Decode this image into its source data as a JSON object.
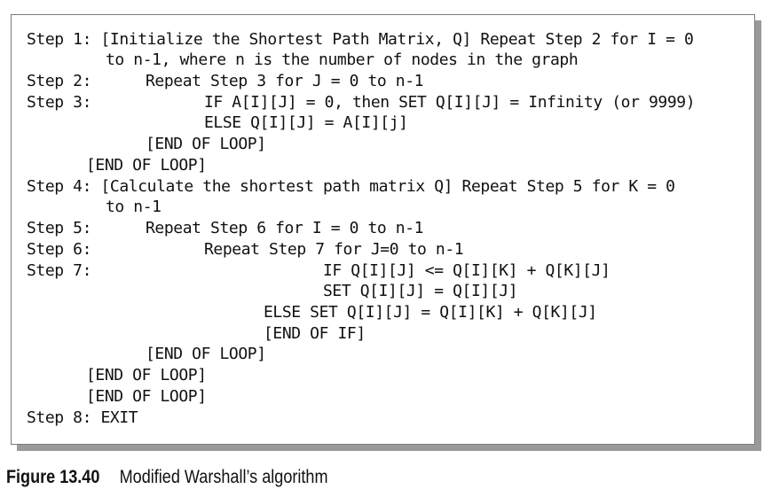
{
  "algorithm": {
    "lines": [
      "Step 1: [Initialize the Shortest Path Matrix, Q] Repeat Step 2 for I = 0",
      "to n-1, where n is the number of nodes in the graph",
      "Step 2:",
      "Repeat Step 3 for J = 0 to n-1",
      "Step 3:",
      "IF A[I][J] = 0, then SET Q[I][J] = Infinity (or 9999)",
      "ELSE Q[I][J] = A[I][j]",
      "[END OF LOOP]",
      "[END OF LOOP]",
      "Step 4: [Calculate the shortest path matrix Q] Repeat Step 5 for K = 0",
      "to n-1",
      "Step 5:",
      "Repeat Step 6 for I = 0 to n-1",
      "Step 6:",
      "Repeat Step 7 for J=0 to n-1",
      "Step 7:",
      "IF Q[I][J] <= Q[I][K] + Q[K][J]",
      "SET Q[I][J] = Q[I][J]",
      "ELSE SET Q[I][J] = Q[I][K] + Q[K][J]",
      "[END OF IF]",
      "[END OF LOOP]",
      "[END OF LOOP]",
      "[END OF LOOP]",
      "Step 8: EXIT"
    ]
  },
  "caption": {
    "figure_number": "Figure 13.40",
    "text": "Modified Warshall’s algorithm"
  }
}
